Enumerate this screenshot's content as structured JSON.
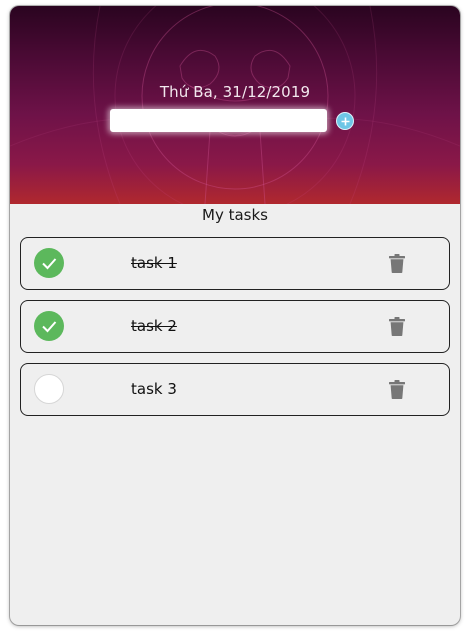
{
  "header": {
    "date": "Thứ Ba, 31/12/2019",
    "input": {
      "value": "",
      "placeholder": ""
    },
    "add_icon": "plus-circle-icon"
  },
  "list": {
    "title": "My tasks",
    "tasks": [
      {
        "label": "task 1",
        "completed": true
      },
      {
        "label": "task 2",
        "completed": true
      },
      {
        "label": "task 3",
        "completed": false
      }
    ]
  },
  "icons": {
    "check": "check-icon",
    "delete": "trash-icon"
  },
  "colors": {
    "header_top": "#2a0420",
    "header_bottom": "#b0282e",
    "done_check": "#5cb85c",
    "add_button": "#6ec6e6",
    "trash": "#777777",
    "background": "#efefef"
  }
}
